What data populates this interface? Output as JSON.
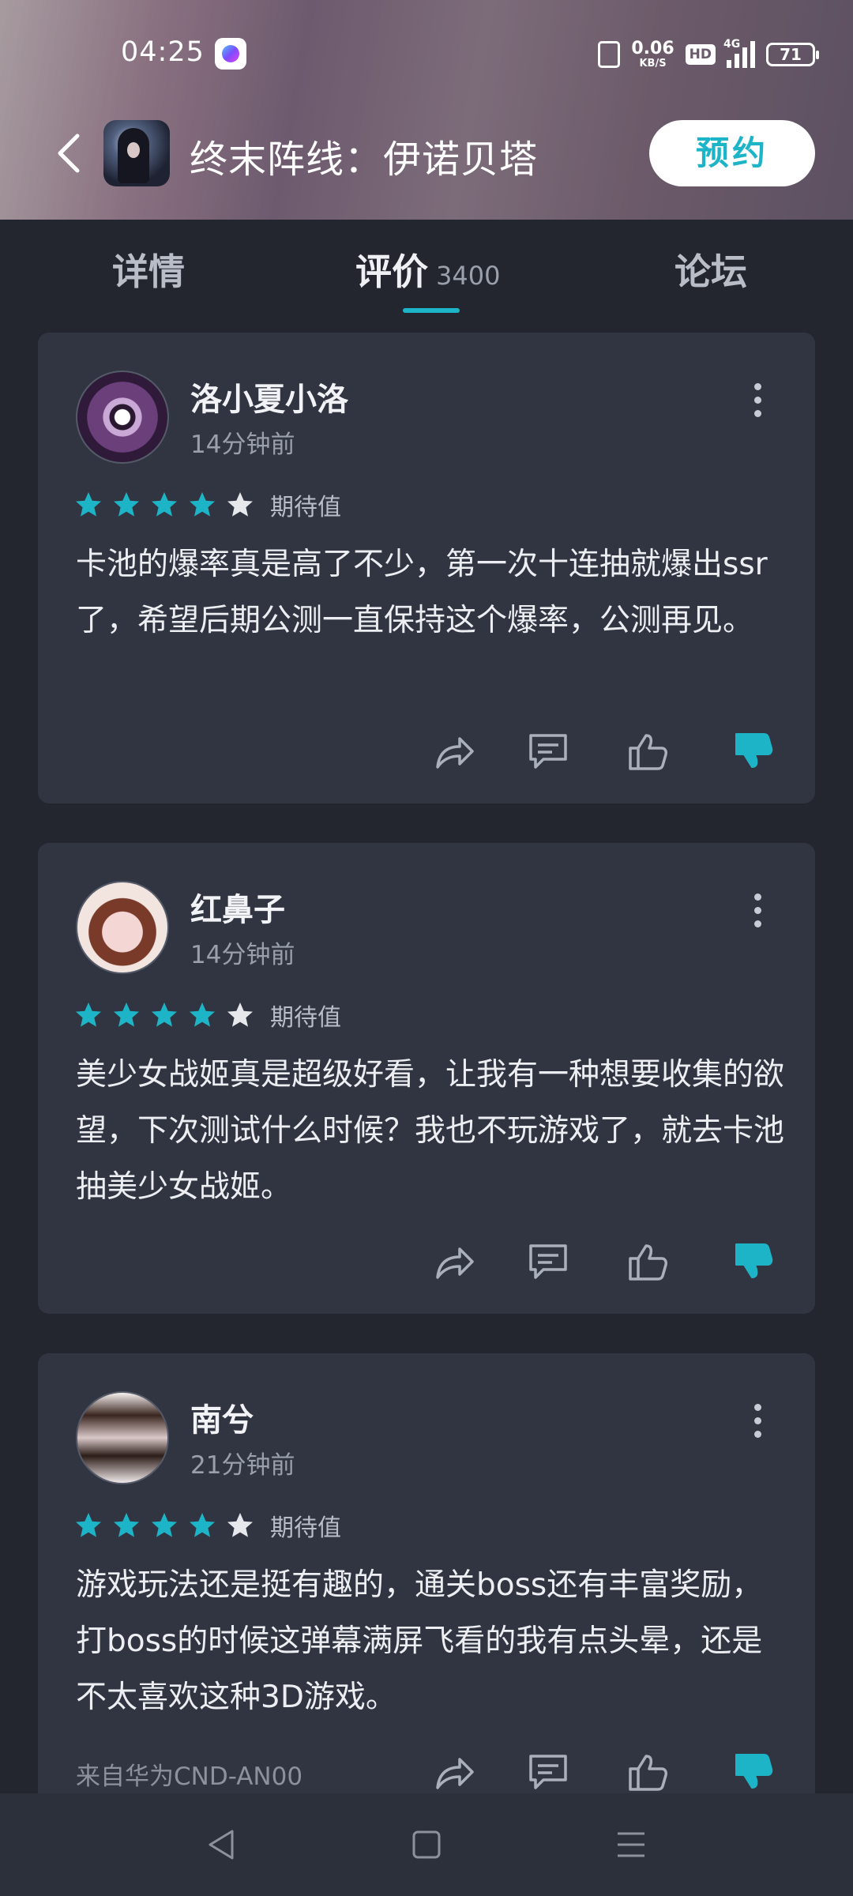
{
  "status_bar": {
    "time": "04:25",
    "net_speed_value": "0.06",
    "net_speed_unit": "KB/S",
    "hd": "HD",
    "network": "4G",
    "battery": "71"
  },
  "header": {
    "title": "终末阵线：伊诺贝塔",
    "reserve_label": "预约"
  },
  "tabs": [
    {
      "label": "详情"
    },
    {
      "label": "评价",
      "count": "3400"
    },
    {
      "label": "论坛"
    }
  ],
  "active_tab": 1,
  "accent_color": "#1db4c7",
  "reviews": [
    {
      "name": "洛小夏小洛",
      "time": "14分钟前",
      "rating": 4,
      "rating_max": 5,
      "rating_label": "期待值",
      "text": "卡池的爆率真是高了不少，第一次十连抽就爆出ssr了，希望后期公测一直保持这个爆率，公测再见。"
    },
    {
      "name": "红鼻子",
      "time": "14分钟前",
      "rating": 4,
      "rating_max": 5,
      "rating_label": "期待值",
      "text": "美少女战姬真是超级好看，让我有一种想要收集的欲望，下次测试什么时候？我也不玩游戏了，就去卡池抽美少女战姬。"
    },
    {
      "name": "南兮",
      "time": "21分钟前",
      "rating": 4,
      "rating_max": 5,
      "rating_label": "期待值",
      "text": "游戏玩法还是挺有趣的，通关boss还有丰富奖励，打boss的时候这弹幕满屏飞看的我有点头晕，还是不太喜欢这种3D游戏。",
      "source": "来自华为CND-AN00"
    }
  ],
  "icons": {
    "share": "share-icon",
    "comment": "comment-icon",
    "like": "thumb-up-icon",
    "dislike": "thumb-down-icon"
  }
}
